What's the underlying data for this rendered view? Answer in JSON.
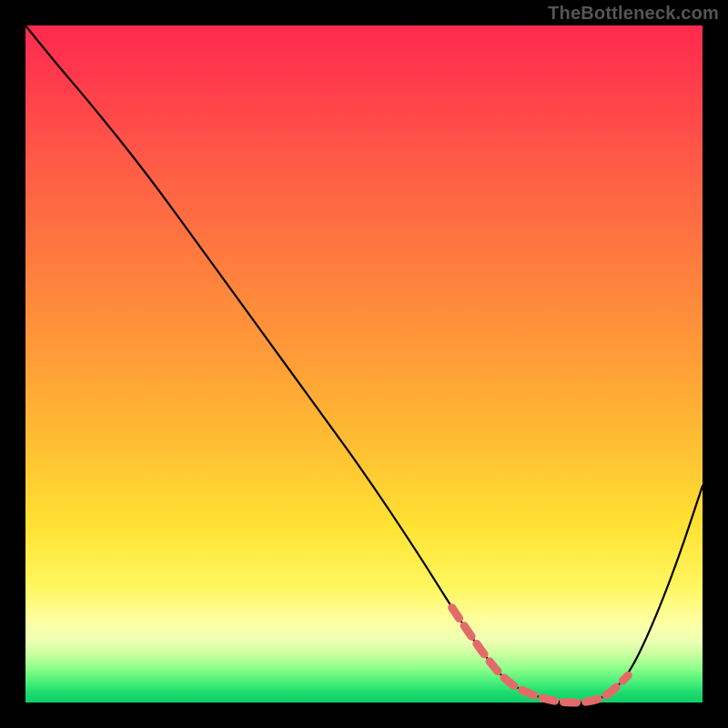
{
  "watermark": "TheBottleneck.com",
  "colors": {
    "curve": "#000000",
    "highlight": "#e46a6a",
    "gradient_top": "#ff2a4f",
    "gradient_bottom": "#0ecf66"
  },
  "chart_data": {
    "type": "line",
    "title": "",
    "xlabel": "",
    "ylabel": "",
    "xlim": [
      0,
      100
    ],
    "ylim": [
      0,
      100
    ],
    "grid": false,
    "legend": false,
    "series": [
      {
        "name": "bottleneck-curve",
        "x": [
          0,
          4,
          10,
          18,
          26,
          34,
          42,
          50,
          58,
          63,
          67,
          71,
          75,
          79,
          83,
          86,
          89,
          92,
          96,
          100
        ],
        "y": [
          100,
          95,
          88,
          78,
          67,
          56,
          45,
          34,
          22,
          14,
          8,
          3,
          1,
          0,
          0,
          1,
          4,
          10,
          20,
          32
        ]
      }
    ],
    "highlight_range": {
      "description": "near-minimum segment of the curve highlighted with dashed markers",
      "x": [
        63,
        67,
        71,
        75,
        79,
        83,
        86,
        89
      ],
      "y": [
        14,
        8,
        3,
        1,
        0,
        0,
        1,
        4
      ]
    }
  }
}
